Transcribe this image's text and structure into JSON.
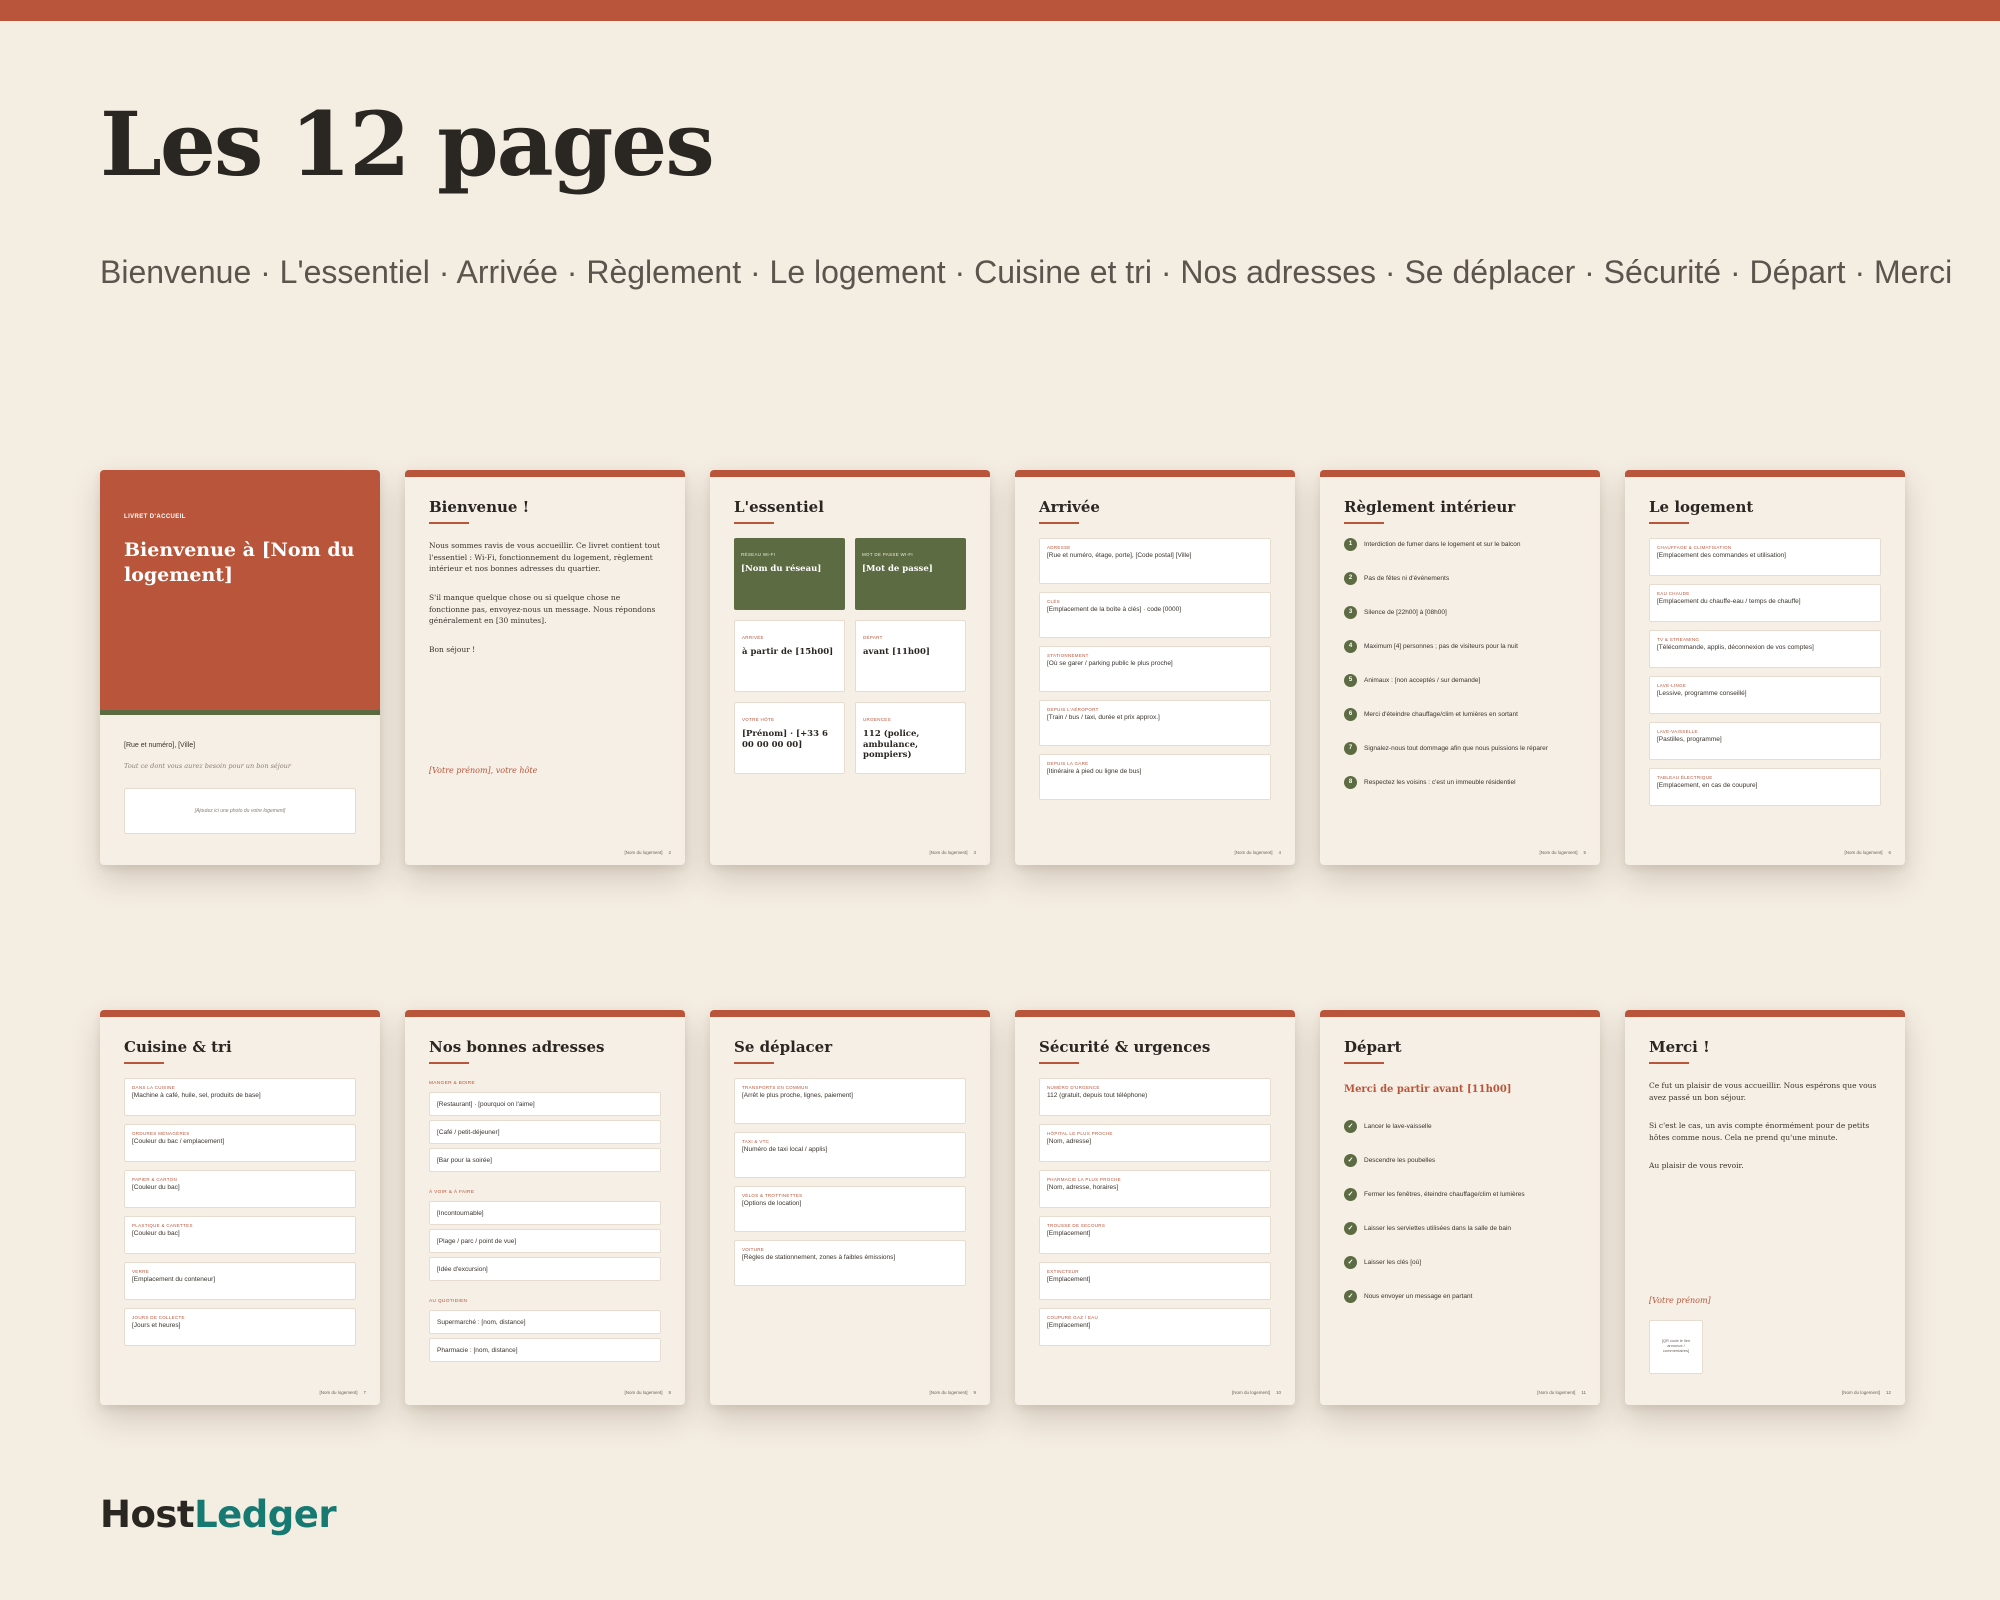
{
  "header": {
    "title": "Les 12 pages",
    "subtitle": "Bienvenue · L'essentiel · Arrivée · Règlement · Le logement · Cuisine et tri · Nos adresses · Se déplacer · Sécurité · Départ · Merci"
  },
  "footer_label": "[Nom du logement]",
  "brand": {
    "part1": "Host",
    "part2": "Ledger"
  },
  "colors": {
    "accent": "#b8553a",
    "green": "#5d6b42",
    "background": "#f4ede2",
    "brand_teal": "#177a72"
  },
  "p1": {
    "label": "LIVRET D'ACCUEIL",
    "title": "Bienvenue à [Nom du logement]",
    "address": "[Rue et numéro], [Ville]",
    "tagline": "Tout ce dont vous aurez besoin pour un bon séjour",
    "photo": "[Ajoutez ici une photo du votre logement]"
  },
  "p2": {
    "title": "Bienvenue !",
    "para1": "Nous sommes ravis de vous accueillir. Ce livret contient tout l'essentiel : Wi-Fi, fonctionnement du logement, règlement intérieur et nos bonnes adresses du quartier.",
    "para2": "S'il manque quelque chose ou si quelque chose ne fonctionne pas, envoyez-nous un message. Nous répondons généralement en [30 minutes].",
    "para3": "Bon séjour !",
    "sign": "[Votre prénom], votre hôte",
    "page": "2"
  },
  "p3": {
    "title": "L'essentiel",
    "tiles": [
      {
        "label": "Réseau Wi-Fi",
        "value": "[Nom du réseau]"
      },
      {
        "label": "Mot de passe Wi-Fi",
        "value": "[Mot de passe]"
      },
      {
        "label": "Arrivée",
        "value": "à partir de [15h00]"
      },
      {
        "label": "Départ",
        "value": "avant [11h00]"
      },
      {
        "label": "Votre hôte",
        "value": "[Prénom] · [+33 6 00 00 00 00]"
      },
      {
        "label": "Urgences",
        "value": "112 (police, ambulance, pompiers)"
      }
    ],
    "page": "3"
  },
  "p4": {
    "title": "Arrivée",
    "items": [
      {
        "label": "Adresse",
        "value": "[Rue et numéro, étage, porte], [Code postal] [Ville]"
      },
      {
        "label": "Clés",
        "value": "[Emplacement de la boîte à clés] · code [0000]"
      },
      {
        "label": "Stationnement",
        "value": "[Où se garer / parking public le plus proche]"
      },
      {
        "label": "Depuis l'aéroport",
        "value": "[Train / bus / taxi, durée et prix approx.]"
      },
      {
        "label": "Depuis la gare",
        "value": "[Itinéraire à pied ou ligne de bus]"
      }
    ],
    "page": "4"
  },
  "p5": {
    "title": "Règlement intérieur",
    "rules": [
      "Interdiction de fumer dans le logement et sur le balcon",
      "Pas de fêtes ni d'événements",
      "Silence de [22h00] à [08h00]",
      "Maximum [4] personnes ; pas de visiteurs pour la nuit",
      "Animaux : [non acceptés / sur demande]",
      "Merci d'éteindre chauffage/clim et lumières en sortant",
      "Signalez-nous tout dommage afin que nous puissions le réparer",
      "Respectez les voisins : c'est un immeuble résidentiel"
    ],
    "page": "5"
  },
  "p6": {
    "title": "Le logement",
    "items": [
      {
        "label": "Chauffage & climatisation",
        "value": "[Emplacement des commandes et utilisation]"
      },
      {
        "label": "Eau chaude",
        "value": "[Emplacement du chauffe-eau / temps de chauffe]"
      },
      {
        "label": "TV & streaming",
        "value": "[Télécommande, applis, déconnexion de vos comptes]"
      },
      {
        "label": "Lave-linge",
        "value": "[Lessive, programme conseillé]"
      },
      {
        "label": "Lave-vaisselle",
        "value": "[Pastilles, programme]"
      },
      {
        "label": "Tableau électrique",
        "value": "[Emplacement, en cas de coupure]"
      }
    ],
    "page": "6"
  },
  "p7": {
    "title": "Cuisine & tri",
    "items": [
      {
        "label": "Dans la cuisine",
        "value": "[Machine à café, huile, sel, produits de base]"
      },
      {
        "label": "Ordures ménagères",
        "value": "[Couleur du bac / emplacement]"
      },
      {
        "label": "Papier & carton",
        "value": "[Couleur du bac]"
      },
      {
        "label": "Plastique & canettes",
        "value": "[Couleur du bac]"
      },
      {
        "label": "Verre",
        "value": "[Emplacement du conteneur]"
      },
      {
        "label": "Jours de collecte",
        "value": "[Jours et heures]"
      }
    ],
    "page": "7"
  },
  "p8": {
    "title": "Nos bonnes adresses",
    "sections": [
      {
        "label": "Manger & boire",
        "items": [
          "[Restaurant] · [pourquoi on l'aime]",
          "[Café / petit-déjeuner]",
          "[Bar pour la soirée]"
        ]
      },
      {
        "label": "À voir & à faire",
        "items": [
          "[Incontournable]",
          "[Plage / parc / point de vue]",
          "[Idée d'excursion]"
        ]
      },
      {
        "label": "Au quotidien",
        "items": [
          "Supermarché : [nom, distance]",
          "Pharmacie : [nom, distance]"
        ]
      }
    ],
    "page": "8"
  },
  "p9": {
    "title": "Se déplacer",
    "items": [
      {
        "label": "Transports en commun",
        "value": "[Arrêt le plus proche, lignes, paiement]"
      },
      {
        "label": "Taxi & VTC",
        "value": "[Numéro de taxi local / applis]"
      },
      {
        "label": "Vélos & trottinettes",
        "value": "[Options de location]"
      },
      {
        "label": "Voiture",
        "value": "[Règles de stationnement, zones à faibles émissions]"
      }
    ],
    "page": "9"
  },
  "p10": {
    "title": "Sécurité & urgences",
    "items": [
      {
        "label": "Numéro d'urgence",
        "value": "112 (gratuit, depuis tout téléphone)"
      },
      {
        "label": "Hôpital le plus proche",
        "value": "[Nom, adresse]"
      },
      {
        "label": "Pharmacie la plus proche",
        "value": "[Nom, adresse, horaires]"
      },
      {
        "label": "Trousse de secours",
        "value": "[Emplacement]"
      },
      {
        "label": "Extincteur",
        "value": "[Emplacement]"
      },
      {
        "label": "Coupure gaz / eau",
        "value": "[Emplacement]"
      }
    ],
    "page": "10"
  },
  "p11": {
    "title": "Départ",
    "subtitle": "Merci de partir avant [11h00]",
    "items": [
      "Lancer le lave-vaisselle",
      "Descendre les poubelles",
      "Fermer les fenêtres, éteindre chauffage/clim et lumières",
      "Laisser les serviettes utilisées dans la salle de bain",
      "Laisser les clés [où]",
      "Nous envoyer un message en partant"
    ],
    "page": "11"
  },
  "p12": {
    "title": "Merci !",
    "para1": "Ce fut un plaisir de vous accueillir. Nous espérons que vous avez passé un bon séjour.",
    "para2": "Si c'est le cas, un avis compte énormément pour de petits hôtes comme nous. Cela ne prend qu'une minute.",
    "para3": "Au plaisir de vous revoir.",
    "sign": "[Votre prénom]",
    "qr": "[QR code le lien annonce / commentaires]",
    "page": "12"
  }
}
